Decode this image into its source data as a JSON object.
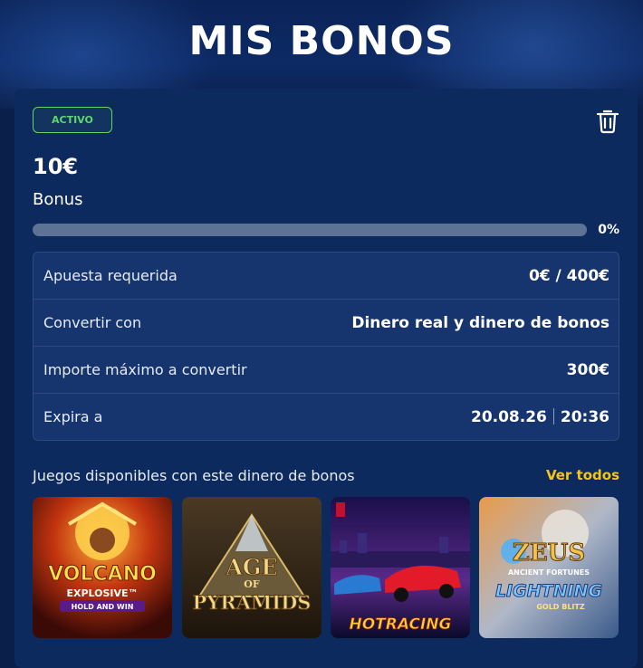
{
  "header": {
    "title": "MIS BONOS"
  },
  "bonus": {
    "status": "ACTIVO",
    "amount": "10€",
    "label": "Bonus",
    "progress_percent": 0,
    "progress_label": "0%",
    "details": [
      {
        "key": "Apuesta requerida",
        "value": "0€ / 400€"
      },
      {
        "key": "Convertir con",
        "value": "Dinero real y dinero de bonos"
      },
      {
        "key": "Importe máximo a convertir",
        "value": "300€"
      },
      {
        "key": "Expira a",
        "date": "20.08.26",
        "time": "20:36"
      }
    ]
  },
  "games": {
    "title": "Juegos disponibles con este dinero de bonos",
    "see_all": "Ver todos",
    "items": [
      {
        "name": "Volcano Explosive",
        "logo_line1": "VOLCANO",
        "logo_line2": "EXPLOSIVE™",
        "logo_line3": "HOLD AND WIN"
      },
      {
        "name": "Age of Pyramids",
        "logo_line1": "AGE",
        "logo_line2": "OF",
        "logo_line3": "PYRAMIDS"
      },
      {
        "name": "Hot Racing",
        "logo_line1": "HOTRACING"
      },
      {
        "name": "Zeus Ancient Fortunes Lightning",
        "logo_line1": "ZEUS",
        "logo_line2": "ANCIENT FORTUNES",
        "logo_line3": "LIGHTNING",
        "logo_line4": "GOLD BLITZ"
      }
    ]
  },
  "colors": {
    "accent_green": "#5ed66e",
    "accent_yellow": "#f5c518",
    "card_bg": "#0d2a5e"
  },
  "icons": {
    "delete": "trash-icon"
  }
}
